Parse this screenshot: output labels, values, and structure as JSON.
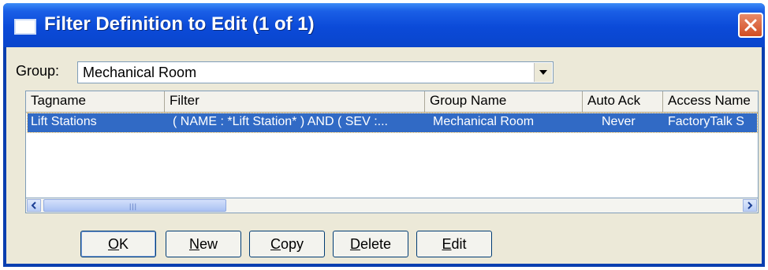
{
  "window": {
    "title": "Filter Definition to Edit (1 of 1)"
  },
  "group": {
    "label": "Group:",
    "value": "Mechanical Room"
  },
  "table": {
    "columns": [
      "Tagname",
      "Filter",
      "Group Name",
      "Auto Ack",
      "Access Name"
    ],
    "rows": [
      {
        "tagname": "Lift Stations",
        "filter": "( NAME : *Lift Station* ) AND ( SEV :...",
        "group_name": "Mechanical Room",
        "auto_ack": "Never",
        "access_name": "FactoryTalk S"
      }
    ]
  },
  "buttons": {
    "ok": {
      "accel": "O",
      "rest": "K"
    },
    "new": {
      "accel": "N",
      "rest": "ew"
    },
    "copy": {
      "accel": "C",
      "rest": "opy"
    },
    "delete": {
      "accel": "D",
      "rest": "elete"
    },
    "edit": {
      "accel": "E",
      "rest": "dit"
    }
  },
  "icons": {
    "close": "close-icon",
    "dropdown": "chevron-down-icon",
    "scroll_left": "scroll-left-icon",
    "scroll_right": "scroll-right-icon"
  },
  "colors": {
    "titlebar": "#0a4ad8",
    "selection": "#316ac5",
    "close": "#d24d22"
  }
}
